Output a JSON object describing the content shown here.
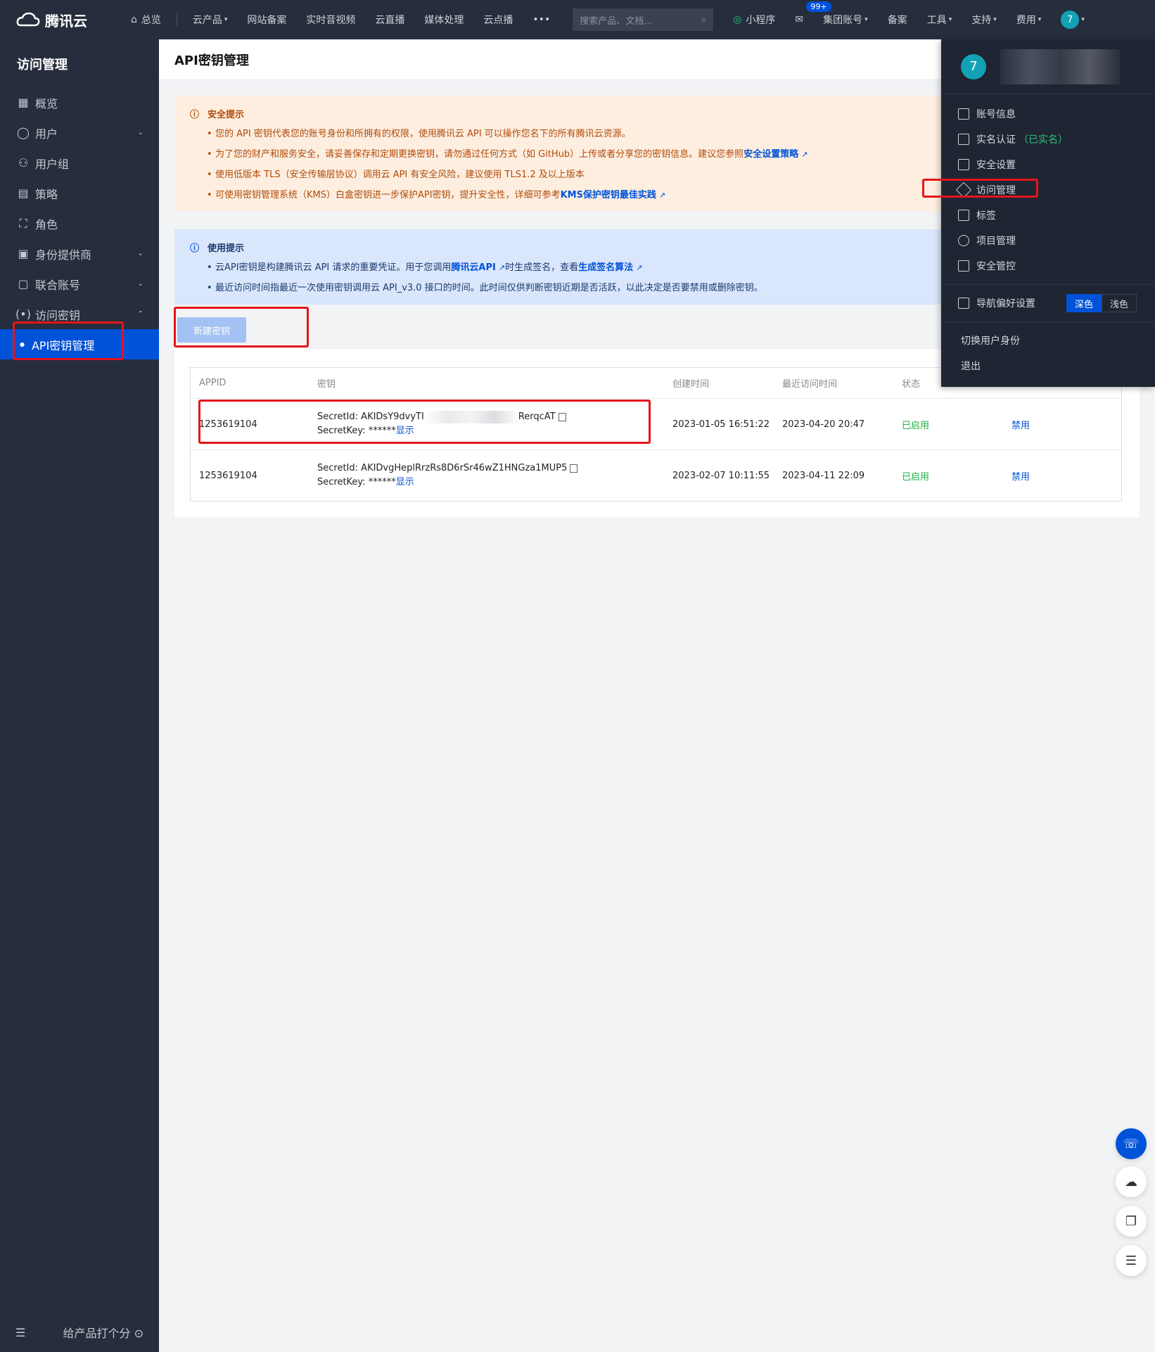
{
  "topbar": {
    "brand": "腾讯云",
    "nav": [
      "总览",
      "云产品",
      "网站备案",
      "实时音视频",
      "云直播",
      "媒体处理",
      "云点播",
      "•••"
    ],
    "search_placeholder": "搜索产品、文档...",
    "right": [
      "小程序",
      "集团账号",
      "备案",
      "工具",
      "支持",
      "费用"
    ],
    "msg_badge": "99+",
    "avatar": "7"
  },
  "sidebar": {
    "title": "访问管理",
    "items": [
      "概览",
      "用户",
      "用户组",
      "策略",
      "角色",
      "身份提供商",
      "联合账号",
      "访问密钥"
    ],
    "sub_item": "API密钥管理",
    "footer": "给产品打个分"
  },
  "page": {
    "title": "API密钥管理"
  },
  "security_alert": {
    "title": "安全提示",
    "lines": [
      "您的 API 密钥代表您的账号身份和所拥有的权限，使用腾讯云 API 可以操作您名下的所有腾讯云资源。",
      "为了您的财产和服务安全，请妥善保存和定期更换密钥，请勿通过任何方式（如 GitHub）上传或者分享您的密钥信息。建议您参照",
      "使用低版本 TLS（安全传输层协议）调用云 API 有安全风险，建议使用 TLS1.2 及以上版本",
      "可使用密钥管理系统（KMS）白盒密钥进一步保护API密钥，提升安全性，详细可参考"
    ],
    "link1": "安全设置策略",
    "link2": "KMS保护密钥最佳实践"
  },
  "usage_alert": {
    "title": "使用提示",
    "line1_pre": "云API密钥是构建腾讯云 API 请求的重要凭证。用于您调用",
    "line1_link": "腾讯云API",
    "line1_mid": "时生成签名，查看",
    "line1_link2": "生成签名算法",
    "line2": "最近访问时间指最近一次使用密钥调用云 API_v3.0 接口的时间。此时间仅供判断密钥近期是否活跃，以此决定是否要禁用或删除密钥。"
  },
  "new_key_button": "新建密钥",
  "table": {
    "headers": [
      "APPID",
      "密钥",
      "创建时间",
      "最近访问时间",
      "状态",
      ""
    ],
    "secret_id_label": "SecretId:",
    "secret_key_label": "SecretKey:",
    "show_label": "显示",
    "rows": [
      {
        "appid": "1253619104",
        "secret_id_start": "AKIDsY9dvyTI",
        "secret_id_end": "RerqcAT",
        "secret_key": "******",
        "created": "2023-01-05 16:51:22",
        "last_access": "2023-04-20 20:47",
        "status": "已启用",
        "action": "禁用"
      },
      {
        "appid": "1253619104",
        "secret_id": "AKIDvgHeplRrzRs8D6rSr46wZ1HNGza1MUP5",
        "secret_key": "******",
        "created": "2023-02-07 10:11:55",
        "last_access": "2023-04-11 22:09",
        "status": "已启用",
        "action": "禁用"
      }
    ]
  },
  "dropdown": {
    "avatar": "7",
    "items": [
      "账号信息",
      "实名认证",
      "安全设置",
      "访问管理",
      "标签",
      "项目管理",
      "安全管控"
    ],
    "verified_tag": "（已实名）",
    "nav_pref": "导航偏好设置",
    "theme_dark": "深色",
    "theme_light": "浅色",
    "switch_identity": "切换用户身份",
    "logout": "退出"
  },
  "colors": {
    "accent": "#0052d9",
    "dark_bg": "#262d3c",
    "highlight": "#e5151a",
    "success": "#1bb13f"
  }
}
